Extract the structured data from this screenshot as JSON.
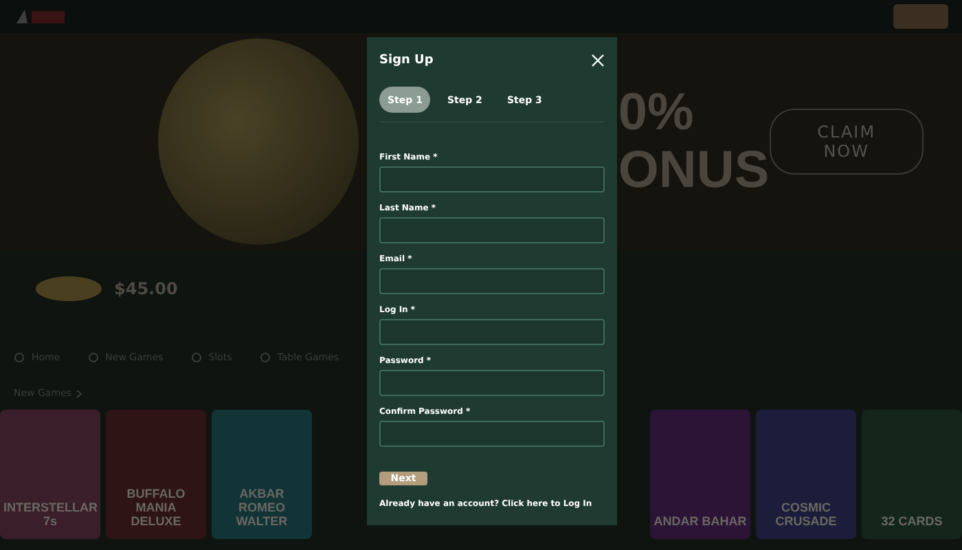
{
  "page": {
    "jackpot": {
      "amount": "$45.00"
    },
    "nav": [
      {
        "label": "Home"
      },
      {
        "label": "New Games"
      },
      {
        "label": "Slots"
      },
      {
        "label": "Table Games"
      }
    ],
    "hero": {
      "headline": "0%",
      "subline": "ONUS",
      "cta": "CLAIM NOW"
    },
    "section_title": "New Games",
    "games_left": [
      {
        "title": "INTERSTELLAR 7s",
        "color": "#3a1f2a"
      },
      {
        "title": "BUFFALO MANIA DELUXE",
        "color": "#2e1414"
      },
      {
        "title": "AKBAR ROMEO WALTER",
        "color": "#123437"
      }
    ],
    "games_right": [
      {
        "title": "ANDAR BAHAR",
        "color": "#2c1436"
      },
      {
        "title": "COSMIC CRUSADE",
        "color": "#1b1d3a"
      },
      {
        "title": "32 CARDS",
        "color": "#14261c"
      }
    ]
  },
  "dialog": {
    "title": "Sign Up",
    "steps": [
      {
        "label": "Step 1",
        "selected": true
      },
      {
        "label": "Step 2",
        "selected": false
      },
      {
        "label": "Step 3",
        "selected": false
      }
    ],
    "fields": [
      {
        "label": "First Name *"
      },
      {
        "label": "Last Name *"
      },
      {
        "label": "Email *"
      },
      {
        "label": "Log In *"
      },
      {
        "label": "Password *"
      },
      {
        "label": "Confirm Password *"
      }
    ],
    "submit": "Next",
    "footer": "Already have an account? Click here to Log In"
  }
}
